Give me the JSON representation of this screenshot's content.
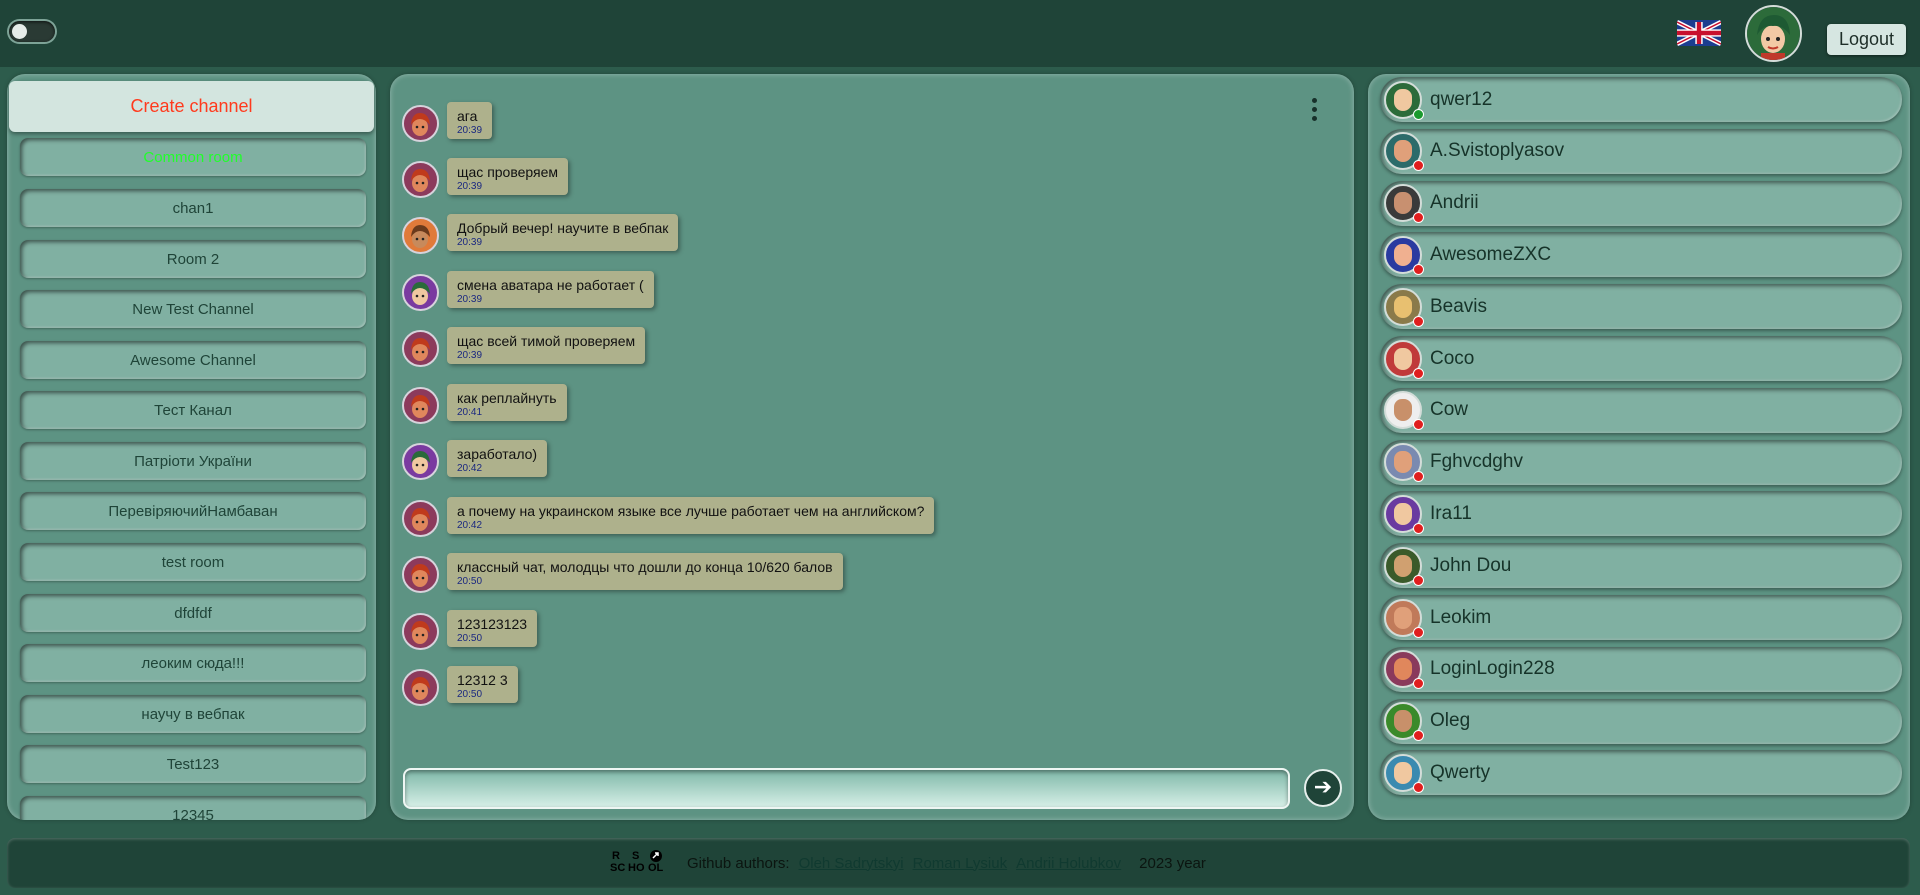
{
  "header": {
    "theme_toggle": "off",
    "language": "EN",
    "logout_label": "Logout"
  },
  "sidebar": {
    "create_channel_label": "Create channel",
    "channels": [
      {
        "name": "Common room",
        "active": true
      },
      {
        "name": "chan1"
      },
      {
        "name": "Room 2"
      },
      {
        "name": "New Test Channel"
      },
      {
        "name": "Awesome Channel"
      },
      {
        "name": "Тест Канал"
      },
      {
        "name": "Патріоти України"
      },
      {
        "name": "ПеревіряючийНамбаван"
      },
      {
        "name": "test room"
      },
      {
        "name": "dfdfdf"
      },
      {
        "name": "леоким сюда!!!"
      },
      {
        "name": "научу в вебпак"
      },
      {
        "name": "Test123"
      },
      {
        "name": "12345"
      }
    ]
  },
  "chat": {
    "messages": [
      {
        "text": "ага",
        "time": "20:39",
        "avatar": "red-hair"
      },
      {
        "text": "щас проверяем",
        "time": "20:39",
        "avatar": "red-hair"
      },
      {
        "text": "Добрый вечер! научите в вебпак",
        "time": "20:39",
        "avatar": "hat-man"
      },
      {
        "text": "смена аватара не работает (",
        "time": "20:39",
        "avatar": "green-hair"
      },
      {
        "text": "щас всей тимой проверяем",
        "time": "20:39",
        "avatar": "red-hair"
      },
      {
        "text": "как реплайнуть",
        "time": "20:41",
        "avatar": "red-hair"
      },
      {
        "text": "заработало)",
        "time": "20:42",
        "avatar": "green-hair"
      },
      {
        "text": "а почему на украинском языке все лучше работает чем на английском?",
        "time": "20:42",
        "avatar": "red-hair"
      },
      {
        "text": "классный чат, молодцы что дошли до конца 10/620 балов",
        "time": "20:50",
        "avatar": "red-hair"
      },
      {
        "text": "123123123",
        "time": "20:50",
        "avatar": "red-hair"
      },
      {
        "text": "12312 3",
        "time": "20:50",
        "avatar": "red-hair"
      }
    ],
    "input_value": "",
    "send_icon": "arrow-right-icon"
  },
  "users": [
    {
      "name": "qwer12",
      "status": "online"
    },
    {
      "name": "A.Svistoplyasov",
      "status": "offline"
    },
    {
      "name": "Andrii",
      "status": "offline"
    },
    {
      "name": "AwesomeZXC",
      "status": "offline"
    },
    {
      "name": "Beavis",
      "status": "offline"
    },
    {
      "name": "Coco",
      "status": "offline"
    },
    {
      "name": "Cow",
      "status": "offline"
    },
    {
      "name": "Fghvcdghv",
      "status": "offline"
    },
    {
      "name": "Ira11",
      "status": "offline"
    },
    {
      "name": "John Dou",
      "status": "offline"
    },
    {
      "name": "Leokim",
      "status": "offline"
    },
    {
      "name": "LoginLogin228",
      "status": "offline"
    },
    {
      "name": "Oleg",
      "status": "offline"
    },
    {
      "name": "Qwerty",
      "status": "offline"
    }
  ],
  "footer": {
    "logo_letters": [
      "R",
      "S",
      "SC",
      "HO",
      "OL"
    ],
    "github_label": "Github authors:",
    "authors": [
      "Oleh Sadrytskyi",
      "Roman Lysiuk",
      "Andrii Holubkov"
    ],
    "year": "2023 year"
  },
  "colors": {
    "background": "#2d5c4c",
    "header": "#1f4438",
    "panel": "#5d9383",
    "item": "#80b0a2",
    "bubble": "#aeb18c",
    "create_channel_text": "#ff3a1d",
    "active_channel": "#20ff2a",
    "online": "#1a9a2e",
    "offline": "#e01e1e"
  }
}
